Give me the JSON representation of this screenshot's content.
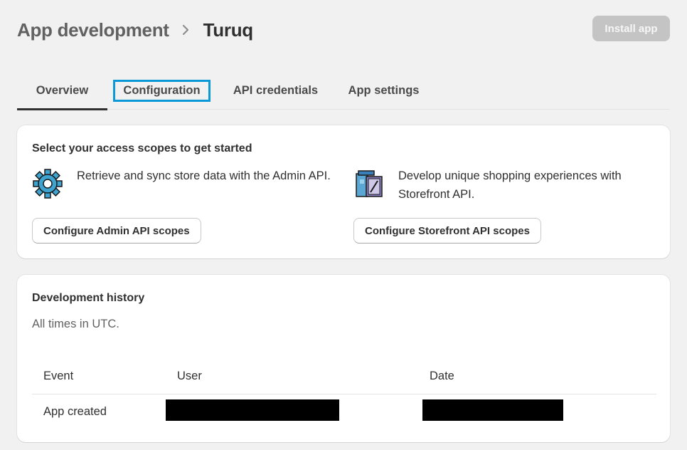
{
  "header": {
    "breadcrumb_parent": "App development",
    "title": "Turuq",
    "install_label": "Install app"
  },
  "tabs": [
    {
      "label": "Overview",
      "active": true
    },
    {
      "label": "Configuration",
      "focused": true
    },
    {
      "label": "API credentials"
    },
    {
      "label": "App settings"
    }
  ],
  "scopes": {
    "title": "Select your access scopes to get started",
    "admin": {
      "description": "Retrieve and sync store data with the Admin API.",
      "button": "Configure Admin API scopes",
      "icon": "gear-icon"
    },
    "storefront": {
      "description": "Develop unique shopping experiences with Storefront API.",
      "button": "Configure Storefront API scopes",
      "icon": "storefront-icon"
    }
  },
  "history": {
    "title": "Development history",
    "subtitle": "All times in UTC.",
    "columns": [
      "Event",
      "User",
      "Date"
    ],
    "rows": [
      {
        "event": "App created"
      }
    ]
  },
  "colors": {
    "focus_outline": "#0a98d6",
    "background": "#f1f1f1",
    "disabled_button": "#c4c4c4"
  }
}
